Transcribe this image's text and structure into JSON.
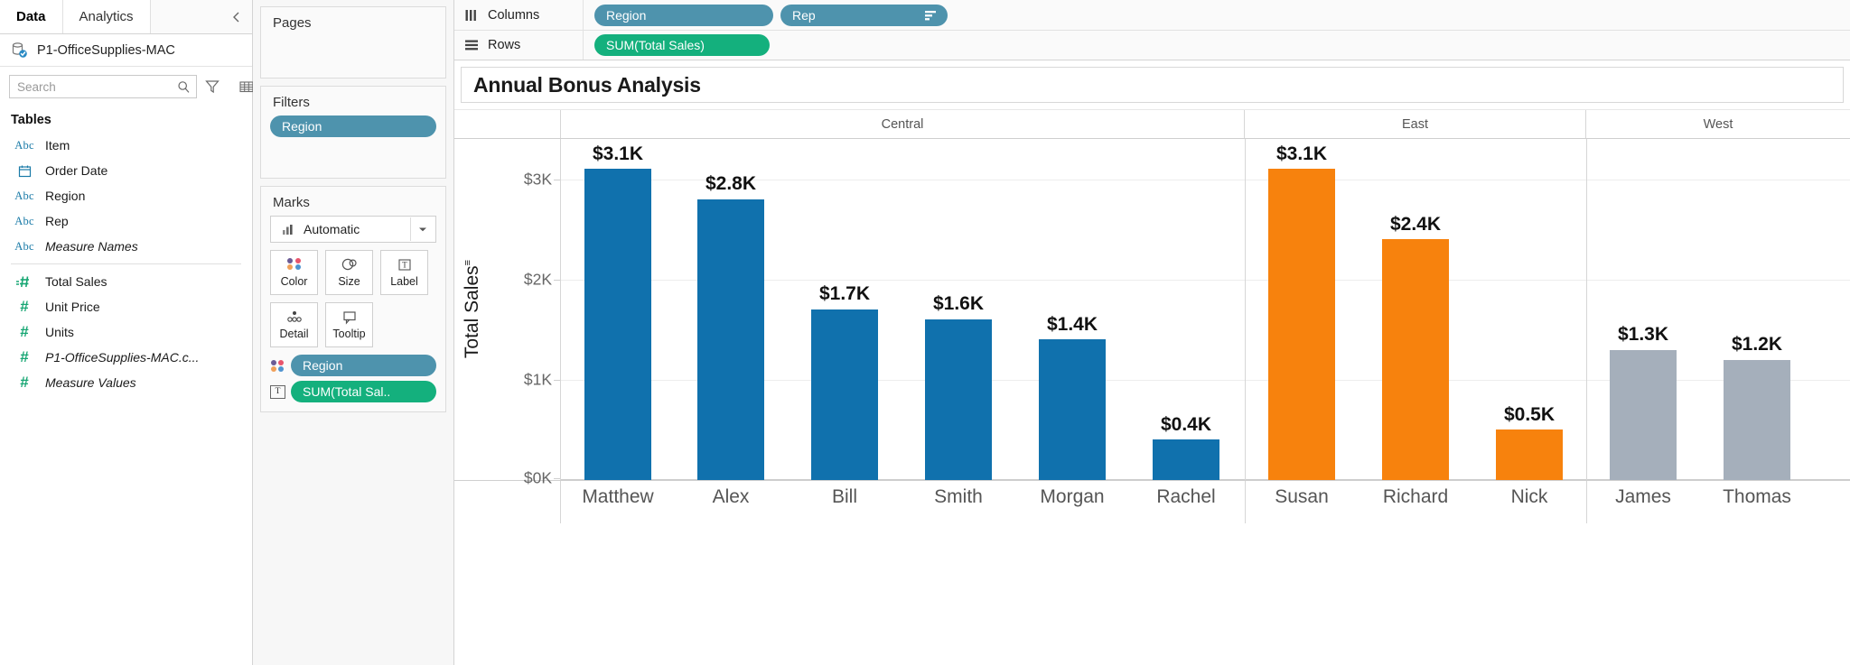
{
  "data_pane": {
    "tabs": [
      {
        "label": "Data",
        "active": true
      },
      {
        "label": "Analytics",
        "active": false
      }
    ],
    "collapse_icon": "chevron-left-icon",
    "data_source": {
      "name": "P1-OfficeSupplies-MAC",
      "icon": "database-icon"
    },
    "search": {
      "placeholder": "Search",
      "value": ""
    },
    "toolbar_icons": [
      "search-icon",
      "filter-funnel-icon",
      "grid-icon",
      "chevron-down-icon"
    ],
    "section_title": "Tables",
    "fields": [
      {
        "label": "Item",
        "type": "abc",
        "icon": "abc-icon",
        "italic": false
      },
      {
        "label": "Order Date",
        "type": "date",
        "icon": "calendar-icon",
        "italic": false
      },
      {
        "label": "Region",
        "type": "abc",
        "icon": "abc-icon",
        "italic": false
      },
      {
        "label": "Rep",
        "type": "abc",
        "icon": "abc-icon",
        "italic": false
      },
      {
        "label": "Measure Names",
        "type": "abc",
        "icon": "abc-icon",
        "italic": true
      },
      {
        "label": "Total Sales",
        "type": "num-calc",
        "icon": "hash-calc-icon",
        "italic": false
      },
      {
        "label": "Unit Price",
        "type": "num",
        "icon": "hash-icon",
        "italic": false
      },
      {
        "label": "Units",
        "type": "num",
        "icon": "hash-icon",
        "italic": false
      },
      {
        "label": "P1-OfficeSupplies-MAC.c...",
        "type": "num",
        "icon": "hash-icon",
        "italic": true
      },
      {
        "label": "Measure Values",
        "type": "num",
        "icon": "hash-icon",
        "italic": true
      }
    ]
  },
  "cards": {
    "pages": {
      "title": "Pages",
      "items": []
    },
    "filters": {
      "title": "Filters",
      "items": [
        {
          "label": "Region",
          "color": "#4e93ad"
        }
      ]
    },
    "marks": {
      "title": "Marks",
      "mark_type": "Automatic",
      "mark_type_icon": "bar-chart-icon",
      "dropdown_icon": "caret-down-icon",
      "buttons": [
        {
          "label": "Color",
          "icon": "color-palette-icon"
        },
        {
          "label": "Size",
          "icon": "size-circles-icon"
        },
        {
          "label": "Label",
          "icon": "label-text-icon"
        },
        {
          "label": "Detail",
          "icon": "detail-dots-icon"
        },
        {
          "label": "Tooltip",
          "icon": "tooltip-bubble-icon"
        }
      ],
      "pills": [
        {
          "label": "Region",
          "color": "#4e93ad",
          "prop_icon": "color-palette-icon"
        },
        {
          "label": "SUM(Total Sal..",
          "color": "#14b07d",
          "prop_icon": "label-text-icon"
        }
      ]
    }
  },
  "shelves": {
    "columns": {
      "label": "Columns",
      "icon": "columns-icon",
      "pills": [
        {
          "label": "Region",
          "color": "#4e93ad",
          "sorted": false
        },
        {
          "label": "Rep",
          "color": "#4e93ad",
          "sorted": true,
          "sort_icon": "sort-descending-icon"
        }
      ]
    },
    "rows": {
      "label": "Rows",
      "icon": "rows-icon",
      "pills": [
        {
          "label": "SUM(Total Sales)",
          "color": "#14b07d",
          "sorted": false
        }
      ]
    }
  },
  "sheet": {
    "title": "Annual Bonus Analysis"
  },
  "chart_data": {
    "type": "bar",
    "title": "Annual Bonus Analysis",
    "xlabel": "",
    "ylabel": "Total Sales",
    "ylabel_sort_icon": "sort-descending-icon",
    "ylim": [
      0,
      3400
    ],
    "ytick_values": [
      0,
      1000,
      2000,
      3000
    ],
    "ytick_labels": [
      "$0K",
      "$1K",
      "$2K",
      "$3K"
    ],
    "grid": true,
    "legend": "none",
    "group_field": "Region",
    "category_field": "Rep",
    "groups": [
      {
        "name": "Central",
        "color": "#1071AD",
        "categories": [
          "Matthew",
          "Alex",
          "Bill",
          "Smith",
          "Morgan",
          "Rachel"
        ],
        "values": [
          3100,
          2800,
          1700,
          1600,
          1400,
          400
        ],
        "labels": [
          "$3.1K",
          "$2.8K",
          "$1.7K",
          "$1.6K",
          "$1.4K",
          "$0.4K"
        ]
      },
      {
        "name": "East",
        "color": "#F7820D",
        "categories": [
          "Susan",
          "Richard",
          "Nick"
        ],
        "values": [
          3100,
          2400,
          500
        ],
        "labels": [
          "$3.1K",
          "$2.4K",
          "$0.5K"
        ]
      },
      {
        "name": "West",
        "color": "#A5AFBB",
        "categories": [
          "James",
          "Thomas"
        ],
        "values": [
          1300,
          1200
        ],
        "labels": [
          "$1.3K",
          "$1.2K"
        ]
      }
    ]
  }
}
